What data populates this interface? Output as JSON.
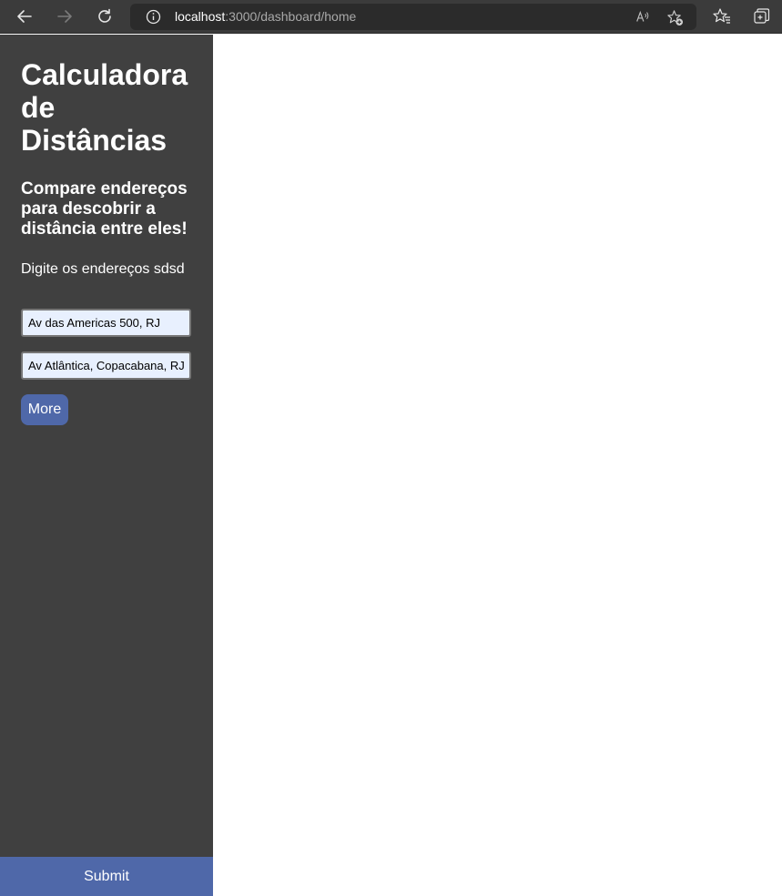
{
  "browser": {
    "url_host": "localhost",
    "url_rest": ":3000/dashboard/home",
    "icons": [
      "back-arrow-icon",
      "forward-arrow-icon",
      "refresh-icon",
      "info-icon",
      "read-aloud-icon",
      "add-favorite-icon",
      "favorites-icon",
      "collections-icon"
    ]
  },
  "sidebar": {
    "title": "Calculadora de Distâncias",
    "subtitle": "Compare endereços para descobrir a distância entre eles!",
    "instruction": "Digite os endereços sdsd",
    "address_1": "Av das Americas 500, RJ",
    "address_2": "Av Atlântica, Copacabana, RJ",
    "more_label": "More",
    "submit_label": "Submit"
  },
  "colors": {
    "sidebar_bg": "#404040",
    "button_accent": "#4f68a9",
    "input_bg": "#e8f0fe"
  }
}
